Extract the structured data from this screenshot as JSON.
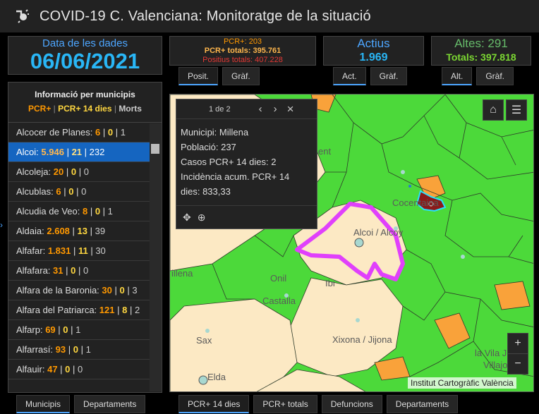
{
  "header": {
    "title": "COVID-19 C. Valenciana: Monitoratge de la situació"
  },
  "date": {
    "label": "Data de les dades",
    "value": "06/06/2021"
  },
  "pcr": {
    "line1": "PCR+: 203",
    "line2": "PCR+ totals: 395.761",
    "line3": "Positius totals: 407.228"
  },
  "actius": {
    "label": "Actius",
    "value": "1.969"
  },
  "altes": {
    "label": "Altes: 291",
    "value": "Totals: 397.818"
  },
  "tabs_pcr": [
    "Posit.",
    "Gràf."
  ],
  "tabs_act": [
    "Act.",
    "Gràf."
  ],
  "tabs_alt": [
    "Alt.",
    "Gràf."
  ],
  "municipis": {
    "title": "Informació per municipis",
    "legend_a": "PCR+",
    "legend_b": "PCR+ 14 dies",
    "legend_c": "Morts",
    "items": [
      {
        "name": "Alcocer de Planes:",
        "a": "6",
        "b": "0",
        "c": "1"
      },
      {
        "name": "Alcoi:",
        "a": "5.946",
        "b": "21",
        "c": "232"
      },
      {
        "name": "Alcoleja:",
        "a": "20",
        "b": "0",
        "c": "0"
      },
      {
        "name": "Alcublas:",
        "a": "6",
        "b": "0",
        "c": "0"
      },
      {
        "name": "Alcudia de Veo:",
        "a": "8",
        "b": "0",
        "c": "1"
      },
      {
        "name": "Aldaia:",
        "a": "2.608",
        "b": "13",
        "c": "39"
      },
      {
        "name": "Alfafar:",
        "a": "1.831",
        "b": "11",
        "c": "30"
      },
      {
        "name": "Alfafara:",
        "a": "31",
        "b": "0",
        "c": "0"
      },
      {
        "name": "Alfara de la Baronia:",
        "a": "30",
        "b": "0",
        "c": "3"
      },
      {
        "name": "Alfara del Patriarca:",
        "a": "121",
        "b": "8",
        "c": "2"
      },
      {
        "name": "Alfarp:",
        "a": "69",
        "b": "0",
        "c": "1"
      },
      {
        "name": "Alfarrasí:",
        "a": "93",
        "b": "0",
        "c": "1"
      },
      {
        "name": "Alfauir:",
        "a": "47",
        "b": "0",
        "c": "0"
      }
    ]
  },
  "side_tabs": [
    "Municipis",
    "Departaments"
  ],
  "map_tabs": [
    "PCR+ 14 dies",
    "PCR+ totals",
    "Defuncions",
    "Departaments"
  ],
  "popup": {
    "page": "1 de 2",
    "line1": "Municipi: Millena",
    "line2": "Població: 237",
    "line3": "Casos PCR+ 14 dies: 2",
    "line4": "Incidència acum. PCR+ 14",
    "line5": "dies: 833,33"
  },
  "map_labels": {
    "cocentaina": "Cocentaina",
    "alcoi": "Alcoi / Alcoy",
    "onil": "Onil",
    "ibi": "Ibi",
    "castalla": "Castalla",
    "xixona": "Xixona / Jijona",
    "sax": "Sax",
    "elda": "Elda",
    "millena": "illena",
    "vilajoyosa": "la Vila J",
    "villajoyosa": "Villajo",
    "onteniente": "ent"
  },
  "attribution": "Institut Cartogràfic València",
  "colors": {
    "green": "#4cd93a",
    "beige": "#fce9c4",
    "orange": "#f9a23a",
    "highlight": "#e040fb",
    "accent": "#4da6ff"
  }
}
